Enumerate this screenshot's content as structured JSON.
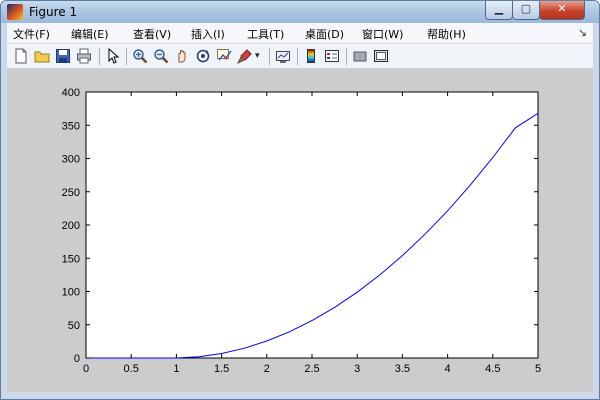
{
  "window": {
    "title": "Figure 1",
    "minimize": "▁",
    "maximize": "▢",
    "close": "✕"
  },
  "menu": [
    "文件(F)",
    "编辑(E)",
    "查看(V)",
    "插入(I)",
    "工具(T)",
    "桌面(D)",
    "窗口(W)",
    "帮助(H)"
  ],
  "menu_overflow": "↘",
  "toolbar": [
    "new-figure",
    "open-file",
    "save",
    "print",
    "pointer",
    "zoom-in",
    "zoom-out",
    "pan",
    "rotate-3d",
    "data-cursor",
    "brush",
    "brush-dropdown",
    "link-plot",
    "colorbar",
    "legend",
    "hide-plot-tools",
    "show-plot-tools"
  ],
  "chart_data": {
    "type": "line",
    "x": [
      0,
      0.5,
      1,
      1.25,
      1.5,
      1.75,
      2,
      2.25,
      2.5,
      2.75,
      3,
      3.25,
      3.5,
      3.75,
      4,
      4.25,
      4.5,
      4.75,
      5
    ],
    "y": [
      0,
      0,
      0,
      1.9,
      6.8,
      14.6,
      25.6,
      39.4,
      56.3,
      76.1,
      99,
      124.9,
      154,
      186.1,
      221.4,
      259.9,
      301.5,
      346.2,
      368
    ],
    "xlim": [
      0,
      5
    ],
    "ylim": [
      0,
      400
    ],
    "xticks": [
      "0",
      "0.5",
      "1",
      "1.5",
      "2",
      "2.5",
      "3",
      "3.5",
      "4",
      "4.5",
      "5"
    ],
    "yticks": [
      "0",
      "50",
      "100",
      "150",
      "200",
      "250",
      "300",
      "350",
      "400"
    ],
    "line_color": "#0000ff",
    "grid": false,
    "legend": false
  }
}
